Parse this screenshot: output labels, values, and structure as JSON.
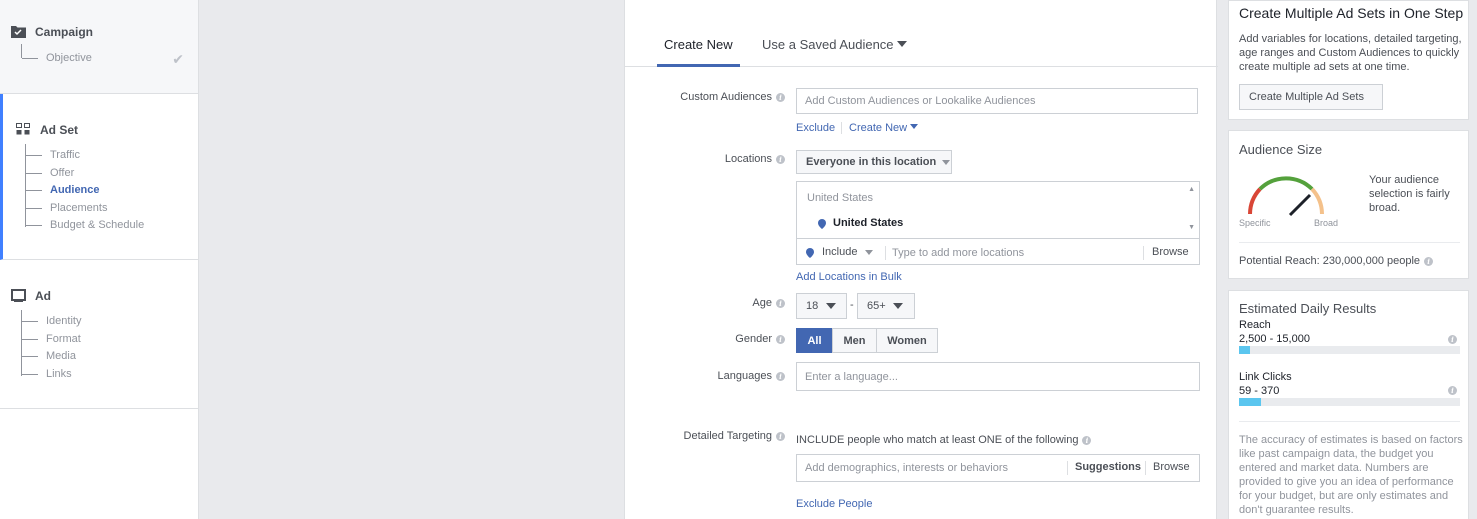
{
  "nav": {
    "campaign": {
      "title": "Campaign",
      "items": [
        "Objective"
      ]
    },
    "adset": {
      "title": "Ad Set",
      "items": [
        "Traffic",
        "Offer",
        "Audience",
        "Placements",
        "Budget & Schedule"
      ],
      "active": "Audience"
    },
    "ad": {
      "title": "Ad",
      "items": [
        "Identity",
        "Format",
        "Media",
        "Links"
      ]
    }
  },
  "tabs": {
    "create_new": "Create New",
    "saved": "Use a Saved Audience"
  },
  "custom_audiences": {
    "label": "Custom Audiences",
    "placeholder": "Add Custom Audiences or Lookalike Audiences",
    "exclude": "Exclude",
    "create_new": "Create New"
  },
  "locations": {
    "label": "Locations",
    "dropdown": "Everyone in this location",
    "group_header": "United States",
    "selected": "United States",
    "include": "Include",
    "placeholder": "Type to add more locations",
    "browse": "Browse",
    "bulk_link": "Add Locations in Bulk"
  },
  "age": {
    "label": "Age",
    "min": "18",
    "dash": "-",
    "max": "65+"
  },
  "gender": {
    "label": "Gender",
    "all": "All",
    "men": "Men",
    "women": "Women",
    "selected": "All"
  },
  "languages": {
    "label": "Languages",
    "placeholder": "Enter a language..."
  },
  "detailed_targeting": {
    "label": "Detailed Targeting",
    "include_text": "INCLUDE people who match at least ONE of the following",
    "placeholder": "Add demographics, interests or behaviors",
    "suggestions": "Suggestions",
    "browse": "Browse",
    "exclude_link": "Exclude People"
  },
  "multi_adsets": {
    "title": "Create Multiple Ad Sets in One Step",
    "text": "Add variables for locations, detailed targeting, age ranges and Custom Audiences to quickly create multiple ad sets at one time.",
    "button": "Create Multiple Ad Sets"
  },
  "audience_size": {
    "title": "Audience Size",
    "specific": "Specific",
    "broad": "Broad",
    "description": "Your audience selection is fairly broad.",
    "potential_reach": "Potential Reach: 230,000,000 people"
  },
  "estimates": {
    "title": "Estimated Daily Results",
    "reach_label": "Reach",
    "reach_value": "2,500 - 15,000",
    "reach_fraction": 0.05,
    "clicks_label": "Link Clicks",
    "clicks_value": "59 - 370",
    "clicks_fraction": 0.1,
    "disclaimer": "The accuracy of estimates is based on factors like past campaign data, the budget you entered and market data. Numbers are provided to give you an idea of performance for your budget, but are only estimates and don't guarantee results."
  },
  "colors": {
    "accent": "#4267b2",
    "active_nav": "#4080ff",
    "bar_fill": "#5bc6ef"
  }
}
